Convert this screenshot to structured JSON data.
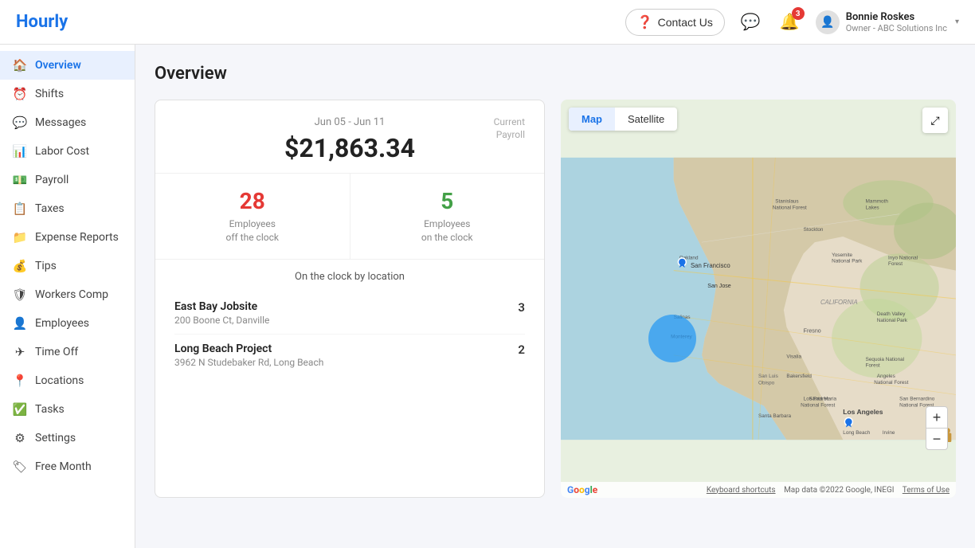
{
  "app": {
    "logo": "Hourly"
  },
  "topnav": {
    "contact_us_label": "Contact Us",
    "notification_count": "3",
    "user": {
      "name": "Bonnie Roskes",
      "role": "Owner - ABC Solutions Inc",
      "avatar_icon": "person"
    }
  },
  "sidebar": {
    "items": [
      {
        "id": "overview",
        "label": "Overview",
        "icon": "🏠",
        "active": true
      },
      {
        "id": "shifts",
        "label": "Shifts",
        "icon": "⏰"
      },
      {
        "id": "messages",
        "label": "Messages",
        "icon": "💬"
      },
      {
        "id": "labor-cost",
        "label": "Labor Cost",
        "icon": "📊"
      },
      {
        "id": "payroll",
        "label": "Payroll",
        "icon": "💵"
      },
      {
        "id": "taxes",
        "label": "Taxes",
        "icon": "📋"
      },
      {
        "id": "expense-reports",
        "label": "Expense Reports",
        "icon": "📁"
      },
      {
        "id": "tips",
        "label": "Tips",
        "icon": "💰"
      },
      {
        "id": "workers-comp",
        "label": "Workers Comp",
        "icon": "🛡"
      },
      {
        "id": "employees",
        "label": "Employees",
        "icon": "👤"
      },
      {
        "id": "time-off",
        "label": "Time Off",
        "icon": "✈"
      },
      {
        "id": "locations",
        "label": "Locations",
        "icon": "📍"
      },
      {
        "id": "tasks",
        "label": "Tasks",
        "icon": "✅"
      },
      {
        "id": "settings",
        "label": "Settings",
        "icon": "⚙"
      },
      {
        "id": "free-month",
        "label": "Free Month",
        "icon": "🏷"
      }
    ]
  },
  "main": {
    "page_title": "Overview",
    "payroll_card": {
      "date_range": "Jun 05 - Jun 11",
      "current_payroll_label": "Current\nPayroll",
      "amount": "$21,863.34",
      "off_clock_count": "28",
      "off_clock_label": "Employees\noff the clock",
      "on_clock_count": "5",
      "on_clock_label": "Employees\non the clock",
      "on_clock_by_location_title": "On the clock by location",
      "locations": [
        {
          "name": "East Bay Jobsite",
          "address": "200 Boone Ct, Danville",
          "count": "3"
        },
        {
          "name": "Long Beach Project",
          "address": "3962 N Studebaker Rd, Long Beach",
          "count": "2"
        }
      ]
    },
    "map": {
      "tab_map": "Map",
      "tab_satellite": "Satellite",
      "zoom_in": "+",
      "zoom_out": "−",
      "footer_keyboard": "Keyboard shortcuts",
      "footer_data": "Map data ©2022 Google, INEGI",
      "footer_terms": "Terms of Use"
    }
  }
}
